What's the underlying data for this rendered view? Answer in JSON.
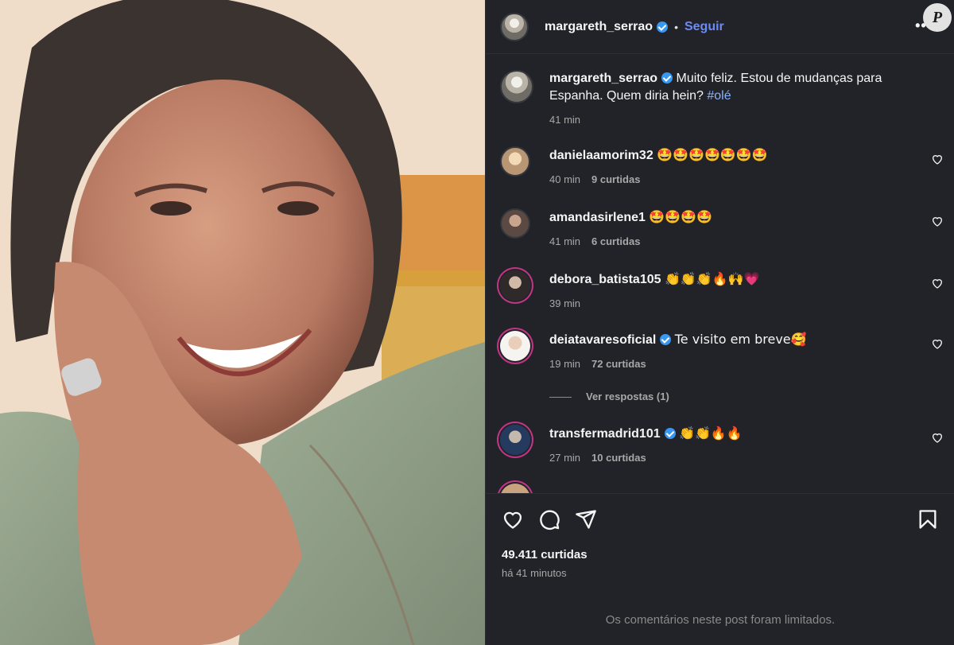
{
  "post": {
    "author": "margareth_serrao",
    "follow_label": "Seguir",
    "separator": "•",
    "more_label": "•••",
    "badge": "P",
    "caption_text": "Muito feliz. Estou de mudanças para Espanha. Quem diria hein?",
    "caption_tag": "#olé",
    "caption_time": "41 min",
    "likes": "49.411 curtidas",
    "posted": "há 41 minutos",
    "limited_note": "Os comentários neste post foram limitados."
  },
  "comments": [
    {
      "user": "danielaamorim32",
      "text": "🤩🤩🤩🤩🤩🤩🤩",
      "time": "40 min",
      "likes": "9 curtidas"
    },
    {
      "user": "amandasirlene1",
      "text": "🤩🤩🤩🤩",
      "time": "41 min",
      "likes": "6 curtidas"
    },
    {
      "user": "debora_batista105",
      "text": "👏👏👏🔥🙌💗",
      "time": "39 min",
      "likes": ""
    },
    {
      "user": "deiatavaresoficial",
      "text": "Te visito em breve🥰",
      "time": "19 min",
      "likes": "72 curtidas"
    },
    {
      "user": "transfermadrid101",
      "text": "👏👏🔥🔥",
      "time": "27 min",
      "likes": "10 curtidas"
    }
  ],
  "replies_label": "Ver respostas (1)",
  "colors": {
    "panel": "#212328",
    "link": "#6b8cf5",
    "verified": "#3897f0",
    "muted": "#a8a8a8"
  }
}
